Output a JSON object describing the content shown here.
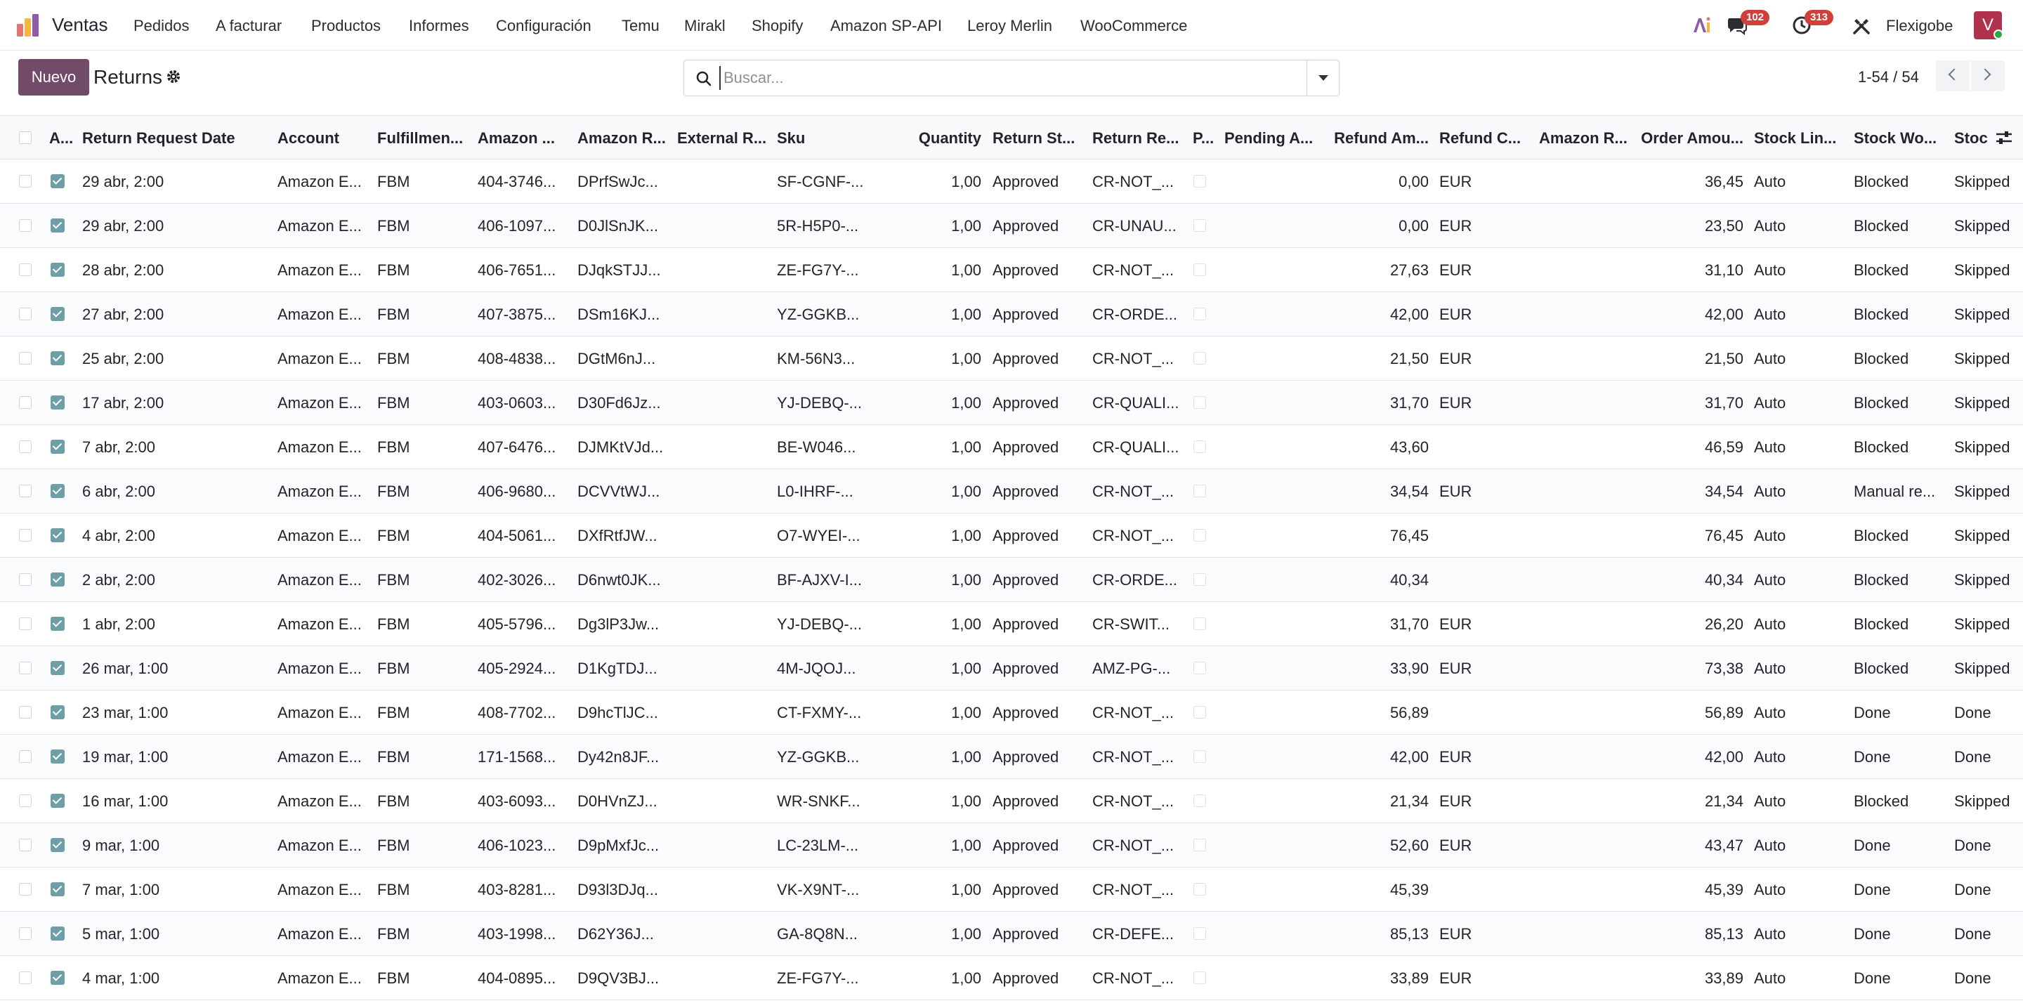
{
  "app": {
    "name": "Ventas",
    "menu": [
      "Pedidos",
      "A facturar",
      "Productos",
      "Informes",
      "Configuración",
      "Temu",
      "Mirakl",
      "Shopify",
      "Amazon SP-API",
      "Leroy Merlin",
      "WooCommerce"
    ],
    "messages_badge": "102",
    "activities_badge": "313",
    "company": "Flexigobe",
    "avatar_letter": "V"
  },
  "control": {
    "new_label": "Nuevo",
    "breadcrumb": "Returns",
    "search_placeholder": "Buscar...",
    "pager": "1-54 / 54"
  },
  "table": {
    "headers": [
      "A...",
      "Return Request Date",
      "Account",
      "Fulfillmen...",
      "Amazon ...",
      "Amazon R...",
      "External R...",
      "Sku",
      "Quantity",
      "Return St...",
      "Return Re...",
      "P...",
      "Pending A...",
      "Refund Am...",
      "Refund C...",
      "Amazon R...",
      "Order Amou...",
      "Stock Lin...",
      "Stock Wo...",
      "Stoc"
    ],
    "rows": [
      [
        "29 abr, 2:00",
        "Amazon E...",
        "FBM",
        "404-3746...",
        "DPrfSwJc...",
        "",
        "SF-CGNF-...",
        "1,00",
        "Approved",
        "CR-NOT_...",
        "",
        "0,00",
        "EUR",
        "",
        "36,45",
        "Auto",
        "Blocked",
        "Skipped"
      ],
      [
        "29 abr, 2:00",
        "Amazon E...",
        "FBM",
        "406-1097...",
        "D0JlSnJK...",
        "",
        "5R-H5P0-...",
        "1,00",
        "Approved",
        "CR-UNAU...",
        "",
        "0,00",
        "EUR",
        "",
        "23,50",
        "Auto",
        "Blocked",
        "Skipped"
      ],
      [
        "28 abr, 2:00",
        "Amazon E...",
        "FBM",
        "406-7651...",
        "DJqkSTJJ...",
        "",
        "ZE-FG7Y-...",
        "1,00",
        "Approved",
        "CR-NOT_...",
        "",
        "27,63",
        "EUR",
        "",
        "31,10",
        "Auto",
        "Blocked",
        "Skipped"
      ],
      [
        "27 abr, 2:00",
        "Amazon E...",
        "FBM",
        "407-3875...",
        "DSm16KJ...",
        "",
        "YZ-GGKB...",
        "1,00",
        "Approved",
        "CR-ORDE...",
        "",
        "42,00",
        "EUR",
        "",
        "42,00",
        "Auto",
        "Blocked",
        "Skipped"
      ],
      [
        "25 abr, 2:00",
        "Amazon E...",
        "FBM",
        "408-4838...",
        "DGtM6nJ...",
        "",
        "KM-56N3...",
        "1,00",
        "Approved",
        "CR-NOT_...",
        "",
        "21,50",
        "EUR",
        "",
        "21,50",
        "Auto",
        "Blocked",
        "Skipped"
      ],
      [
        "17 abr, 2:00",
        "Amazon E...",
        "FBM",
        "403-0603...",
        "D30Fd6Jz...",
        "",
        "YJ-DEBQ-...",
        "1,00",
        "Approved",
        "CR-QUALI...",
        "",
        "31,70",
        "EUR",
        "",
        "31,70",
        "Auto",
        "Blocked",
        "Skipped"
      ],
      [
        "7 abr, 2:00",
        "Amazon E...",
        "FBM",
        "407-6476...",
        "DJMKtVJd...",
        "",
        "BE-W046...",
        "1,00",
        "Approved",
        "CR-QUALI...",
        "",
        "43,60",
        "",
        "",
        "46,59",
        "Auto",
        "Blocked",
        "Skipped"
      ],
      [
        "6 abr, 2:00",
        "Amazon E...",
        "FBM",
        "406-9680...",
        "DCVVtWJ...",
        "",
        "L0-IHRF-...",
        "1,00",
        "Approved",
        "CR-NOT_...",
        "",
        "34,54",
        "EUR",
        "",
        "34,54",
        "Auto",
        "Manual re...",
        "Skipped"
      ],
      [
        "4 abr, 2:00",
        "Amazon E...",
        "FBM",
        "404-5061...",
        "DXfRtfJW...",
        "",
        "O7-WYEI-...",
        "1,00",
        "Approved",
        "CR-NOT_...",
        "",
        "76,45",
        "",
        "",
        "76,45",
        "Auto",
        "Blocked",
        "Skipped"
      ],
      [
        "2 abr, 2:00",
        "Amazon E...",
        "FBM",
        "402-3026...",
        "D6nwt0JK...",
        "",
        "BF-AJXV-I...",
        "1,00",
        "Approved",
        "CR-ORDE...",
        "",
        "40,34",
        "",
        "",
        "40,34",
        "Auto",
        "Blocked",
        "Skipped"
      ],
      [
        "1 abr, 2:00",
        "Amazon E...",
        "FBM",
        "405-5796...",
        "Dg3lP3Jw...",
        "",
        "YJ-DEBQ-...",
        "1,00",
        "Approved",
        "CR-SWIT...",
        "",
        "31,70",
        "EUR",
        "",
        "26,20",
        "Auto",
        "Blocked",
        "Skipped"
      ],
      [
        "26 mar, 1:00",
        "Amazon E...",
        "FBM",
        "405-2924...",
        "D1KgTDJ...",
        "",
        "4M-JQOJ...",
        "1,00",
        "Approved",
        "AMZ-PG-...",
        "",
        "33,90",
        "EUR",
        "",
        "73,38",
        "Auto",
        "Blocked",
        "Skipped"
      ],
      [
        "23 mar, 1:00",
        "Amazon E...",
        "FBM",
        "408-7702...",
        "D9hcTlJC...",
        "",
        "CT-FXMY-...",
        "1,00",
        "Approved",
        "CR-NOT_...",
        "",
        "56,89",
        "",
        "",
        "56,89",
        "Auto",
        "Done",
        "Done"
      ],
      [
        "19 mar, 1:00",
        "Amazon E...",
        "FBM",
        "171-1568...",
        "Dy42n8JF...",
        "",
        "YZ-GGKB...",
        "1,00",
        "Approved",
        "CR-NOT_...",
        "",
        "42,00",
        "EUR",
        "",
        "42,00",
        "Auto",
        "Done",
        "Done"
      ],
      [
        "16 mar, 1:00",
        "Amazon E...",
        "FBM",
        "403-6093...",
        "D0HVnZJ...",
        "",
        "WR-SNKF...",
        "1,00",
        "Approved",
        "CR-NOT_...",
        "",
        "21,34",
        "EUR",
        "",
        "21,34",
        "Auto",
        "Blocked",
        "Skipped"
      ],
      [
        "9 mar, 1:00",
        "Amazon E...",
        "FBM",
        "406-1023...",
        "D9pMxfJc...",
        "",
        "LC-23LM-...",
        "1,00",
        "Approved",
        "CR-NOT_...",
        "",
        "52,60",
        "EUR",
        "",
        "43,47",
        "Auto",
        "Done",
        "Done"
      ],
      [
        "7 mar, 1:00",
        "Amazon E...",
        "FBM",
        "403-8281...",
        "D93l3DJq...",
        "",
        "VK-X9NT-...",
        "1,00",
        "Approved",
        "CR-NOT_...",
        "",
        "45,39",
        "",
        "",
        "45,39",
        "Auto",
        "Done",
        "Done"
      ],
      [
        "5 mar, 1:00",
        "Amazon E...",
        "FBM",
        "403-1998...",
        "D62Y36J...",
        "",
        "GA-8Q8N...",
        "1,00",
        "Approved",
        "CR-DEFE...",
        "",
        "85,13",
        "EUR",
        "",
        "85,13",
        "Auto",
        "Done",
        "Done"
      ],
      [
        "4 mar, 1:00",
        "Amazon E...",
        "FBM",
        "404-0895...",
        "D9QV3BJ...",
        "",
        "ZE-FG7Y-...",
        "1,00",
        "Approved",
        "CR-NOT_...",
        "",
        "33,89",
        "EUR",
        "",
        "33,89",
        "Auto",
        "Done",
        "Done"
      ]
    ]
  },
  "colors": {
    "brand": "#714b67",
    "badge": "#d23f3a",
    "checkbox_checked": "#6e9fa6",
    "avatar": "#b0324c"
  }
}
